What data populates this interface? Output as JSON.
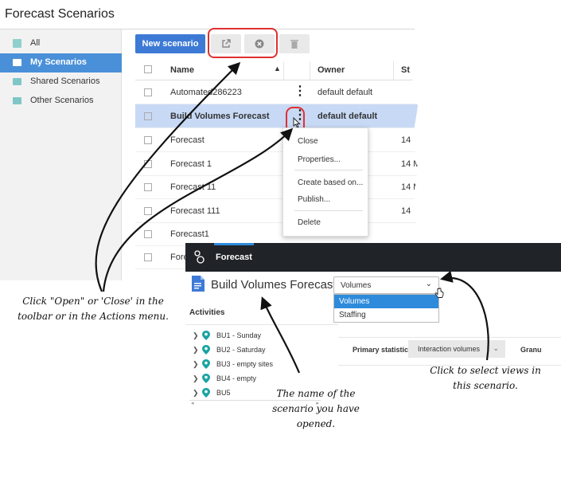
{
  "window1": {
    "title": "Forecast Scenarios",
    "sidebar": [
      {
        "label": "All",
        "icon": "folder-stack-icon",
        "selected": false
      },
      {
        "label": "My Scenarios",
        "icon": "folder-icon",
        "selected": true
      },
      {
        "label": "Shared Scenarios",
        "icon": "folder-icon",
        "selected": false
      },
      {
        "label": "Other Scenarios",
        "icon": "folder-icon",
        "selected": false
      }
    ],
    "toolbar": {
      "new_scenario": "New scenario",
      "open_icon": "external-link-icon",
      "close_icon": "circle-x-icon",
      "delete_icon": "trash-icon"
    },
    "table": {
      "columns": {
        "name": "Name",
        "owner": "Owner",
        "start": "St"
      },
      "rows": [
        {
          "name": "Automated286223",
          "owner": "default default",
          "date": "",
          "selected": false,
          "kebab": true
        },
        {
          "name": "Build Volumes Forecast",
          "owner": "default default",
          "date": "",
          "selected": true,
          "kebab": true
        },
        {
          "name": "Forecast",
          "owner": "",
          "date": "14",
          "selected": false,
          "kebab": false
        },
        {
          "name": "Forecast 1",
          "owner": "",
          "date": "14 M",
          "selected": false,
          "kebab": false
        },
        {
          "name": "Forecast 11",
          "owner": "",
          "date": "14 M",
          "selected": false,
          "kebab": false
        },
        {
          "name": "Forecast 111",
          "owner": "",
          "date": "14",
          "selected": false,
          "kebab": false
        },
        {
          "name": "Forecast1",
          "owner": "",
          "date": "",
          "selected": false,
          "kebab": false
        },
        {
          "name": "Fore",
          "owner": "",
          "date": "",
          "selected": false,
          "kebab": false
        }
      ]
    },
    "actions_menu": [
      "Close",
      "Properties...",
      "Create based on...",
      "Publish...",
      "Delete"
    ]
  },
  "window2": {
    "tab": "Forecast",
    "scenario_title": "Build Volumes Forecast",
    "view_select": {
      "value": "Volumes",
      "options": [
        "Volumes",
        "Staffing"
      ]
    },
    "activities_label": "Activities",
    "activities": [
      "BU1 - Sunday",
      "BU2 - Saturday",
      "BU3 - empty sites",
      "BU4 - empty",
      "BU5"
    ],
    "primary_statistic_label": "Primary statistic",
    "primary_statistic_value": "Interaction volumes",
    "granularity_label": "Granu"
  },
  "annotations": {
    "open_close": "Click \"Open\" or 'Close' in the toolbar or in the Actions menu.",
    "scenario_name": "The name of the scenario you have opened.",
    "select_views": "Click to select views in this scenario."
  },
  "colors": {
    "accent": "#3d7ad6",
    "selected_row": "#c7d9f5",
    "highlight": "#e03030",
    "topbar": "#202327"
  }
}
